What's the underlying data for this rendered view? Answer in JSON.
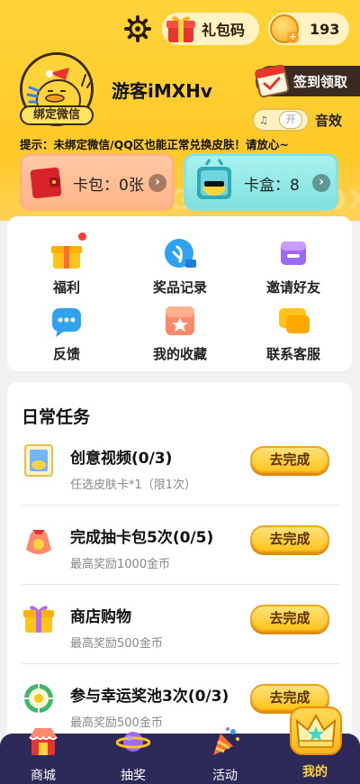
{
  "header": {
    "gift_label": "礼包码",
    "coins": "193",
    "username": "游客iMXHv",
    "bind_label": "绑定微信",
    "checkin_label": "签到领取",
    "sound_label": "音效",
    "sound_toggle_on": "开",
    "tip": "提示：未绑定微信/QQ区也能正常兑换皮肤！请放心~"
  },
  "cards": {
    "pack_label": "卡包：0张",
    "box_label": "卡盒：8",
    "watermark": "CARDBAG CARDBOX"
  },
  "menu": [
    {
      "label": "福利",
      "icon": "gift-box-icon"
    },
    {
      "label": "奖品记录",
      "icon": "record-icon"
    },
    {
      "label": "邀请好友",
      "icon": "invite-icon"
    },
    {
      "label": "反馈",
      "icon": "feedback-icon"
    },
    {
      "label": "我的收藏",
      "icon": "favorite-icon"
    },
    {
      "label": "联系客服",
      "icon": "customer-service-icon"
    }
  ],
  "tasks": {
    "title": "日常任务",
    "items": [
      {
        "name": "创意视频(0/3)",
        "desc": "任选皮肤卡*1（限1次）",
        "button": "去完成",
        "icon": "video-card-icon"
      },
      {
        "name": "完成抽卡包5次(0/5)",
        "desc": "最高奖励1000金币",
        "button": "去完成",
        "icon": "lucky-bag-icon"
      },
      {
        "name": "商店购物",
        "desc": "最高奖励500金币",
        "button": "去完成",
        "icon": "shop-gift-icon"
      },
      {
        "name": "参与幸运奖池3次(0/3)",
        "desc": "最高奖励500金币",
        "button": "去完成",
        "icon": "lucky-pool-icon"
      }
    ]
  },
  "tabs": [
    {
      "label": "商城",
      "icon": "shop-icon"
    },
    {
      "label": "抽奖",
      "icon": "planet-icon"
    },
    {
      "label": "活动",
      "icon": "party-icon"
    },
    {
      "label": "我的",
      "icon": "crown-icon",
      "active": true
    }
  ],
  "colors": {
    "accent_yellow": "#ffd43a",
    "tab_bg": "#2d2a59",
    "button_orange": "#ffc41c"
  }
}
